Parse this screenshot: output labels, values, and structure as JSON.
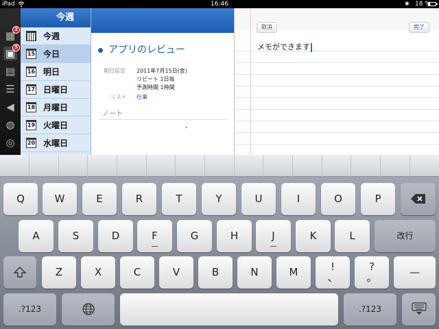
{
  "status": {
    "carrier": "iPad",
    "time": "16:46",
    "battery": "18 %",
    "battery_level": 0.18
  },
  "rail": {
    "badge_1": "2",
    "badge_2": "5"
  },
  "days": {
    "header": "今週",
    "items": [
      {
        "label": "今週",
        "num": ""
      },
      {
        "label": "今日",
        "num": "15"
      },
      {
        "label": "明日",
        "num": "16"
      },
      {
        "label": "日曜日",
        "num": "17"
      },
      {
        "label": "月曜日",
        "num": "18"
      },
      {
        "label": "火曜日",
        "num": "19"
      },
      {
        "label": "水曜日",
        "num": "20"
      }
    ]
  },
  "task": {
    "title": "アプリのレビュー",
    "due_label": "期日設定",
    "due_value": "2011年7月15日(金)",
    "repeat": "リピート 1日毎",
    "estimate": "予測時間 1時間",
    "list_label": "リスト",
    "list_value": "仕事",
    "note_label": "ノート"
  },
  "memo": {
    "cancel": "取消",
    "done": "完了",
    "text": "メモができます"
  },
  "keyboard": {
    "row1": [
      "Q",
      "W",
      "E",
      "R",
      "T",
      "Y",
      "U",
      "I",
      "O",
      "P"
    ],
    "row2": [
      "A",
      "S",
      "D",
      "F",
      "G",
      "H",
      "J",
      "K",
      "L"
    ],
    "return": "改行",
    "row3": [
      "Z",
      "X",
      "C",
      "V",
      "B",
      "N",
      "M"
    ],
    "excl_top": "!",
    "excl_bottom": "、",
    "q_top": "?",
    "q_bottom": "。",
    "dash": "—",
    "numbers": ".?123"
  }
}
